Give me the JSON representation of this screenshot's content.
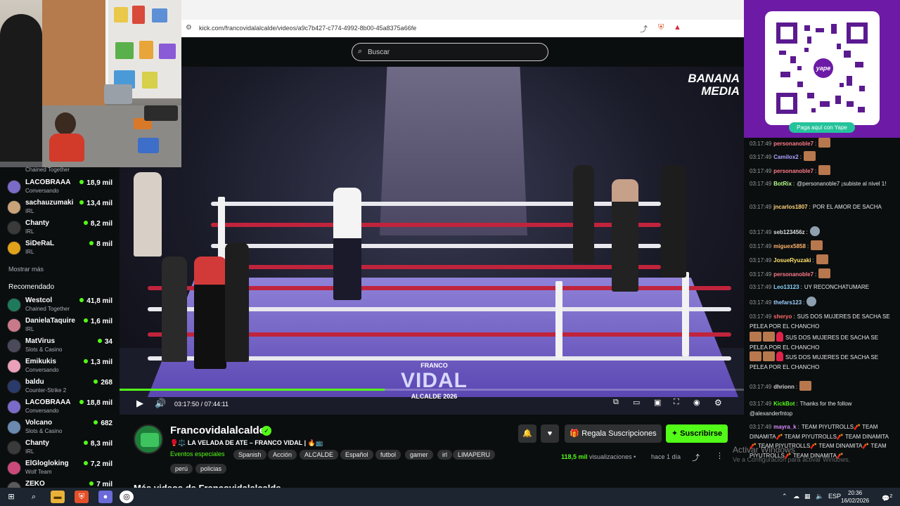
{
  "browser": {
    "url": "kick.com/francovidalalcalde/videos/a9c7b427-c774-4992-8b00-45a8375a66fe"
  },
  "header": {
    "search_placeholder": "Buscar"
  },
  "sidebar": {
    "top_partial_category": "Chained Together",
    "following": [
      {
        "name": "LACOBRAAA",
        "category": "Conversando",
        "viewers": "18,9 mil"
      },
      {
        "name": "sachauzumaki",
        "category": "IRL",
        "viewers": "13,4 mil"
      },
      {
        "name": "Chanty",
        "category": "IRL",
        "viewers": "8,2 mil"
      },
      {
        "name": "SiDeRaL",
        "category": "IRL",
        "viewers": "8 mil"
      }
    ],
    "show_more": "Mostrar más",
    "recommended_label": "Recomendado",
    "recommended": [
      {
        "name": "Westcol",
        "category": "Chained Together",
        "viewers": "41,8 mil"
      },
      {
        "name": "DanielaTaquire",
        "category": "IRL",
        "viewers": "1,6 mil"
      },
      {
        "name": "MatVirus",
        "category": "Slots & Casino",
        "viewers": "34"
      },
      {
        "name": "Emikukis",
        "category": "Conversando",
        "viewers": "1,3 mil"
      },
      {
        "name": "baldu",
        "category": "Counter-Strike 2",
        "viewers": "268"
      },
      {
        "name": "LACOBRAAA",
        "category": "Conversando",
        "viewers": "18,8 mil"
      },
      {
        "name": "Volcano",
        "category": "Slots & Casino",
        "viewers": "682"
      },
      {
        "name": "Chanty",
        "category": "IRL",
        "viewers": "8,3 mil"
      },
      {
        "name": "ElGlogloking",
        "category": "Wolf Team",
        "viewers": "7,2 mil"
      },
      {
        "name": "ZEKO",
        "category": "",
        "viewers": "7 mil"
      }
    ]
  },
  "video": {
    "watermark_line1": "BANANA",
    "watermark_line2": "MEDIA",
    "banner_small": "FRANCO",
    "banner_big": "VIDAL",
    "banner_sub": "ALCALDE 2026",
    "current_time": "03:17:50",
    "separator": "/",
    "duration": "07:44:11",
    "progress_fraction": 0.425
  },
  "channel": {
    "name": "Francovidalalcalde",
    "title": "🥊⚖️  LA VELADA DE ATE – FRANCO VIDAL | 🔥📺",
    "category": "Eventos especiales",
    "tags": [
      "Spanish",
      "Acción",
      "ALCALDE",
      "Español",
      "futbol",
      "gamer",
      "irl",
      "LIMAPERU",
      "perú",
      "policias"
    ],
    "gift_label": "Regala Suscripciones",
    "subscribe_label": "Suscribirse",
    "views_count": "118,5 mil",
    "views_word": "visualizaciones",
    "dot": "•",
    "ago": "hace 1 día",
    "more_videos": "Más videos de Francovidalalcalde"
  },
  "qr": {
    "brand": "yape",
    "caption": "Paga aquí con Yape"
  },
  "chat": [
    {
      "time": "03:17:49",
      "user": "personanoble7",
      "color": "#ff7a8a",
      "text": "",
      "emotes": 1
    },
    {
      "time": "03:17:49",
      "user": "Camilox2",
      "color": "#a9a3ff",
      "text": "",
      "emotes": 1
    },
    {
      "time": "03:17:49",
      "user": "personanoble7",
      "color": "#ff7a8a",
      "text": "",
      "emotes": 1
    },
    {
      "time": "03:17:49",
      "user": "BotRix",
      "color": "#b6ff8a",
      "text": "@personanoble7 ¡subiste al nivel 1!",
      "emotes": 0
    },
    {
      "time": "03:17:49",
      "user": "jncarlos1807",
      "color": "#ffd37a",
      "text": "POR EL AMOR DE SACHA",
      "emotes": 0
    },
    {
      "time": "03:17:49",
      "user": "seb123456z",
      "color": "#dddddd",
      "text": "",
      "emotes": 1
    },
    {
      "time": "03:17:49",
      "user": "miguex5858",
      "color": "#ffb36b",
      "text": "",
      "emotes": 1
    },
    {
      "time": "03:17:49",
      "user": "JosueRyuzaki",
      "color": "#ffe36b",
      "text": "",
      "emotes": 1
    },
    {
      "time": "03:17:49",
      "user": "personanoble7",
      "color": "#ff7a8a",
      "text": "",
      "emotes": 1
    },
    {
      "time": "03:17:49",
      "user": "Leo13123",
      "color": "#8ad2ff",
      "text": "UY RECONCHATUMARE",
      "emotes": 0
    },
    {
      "time": "03:17:49",
      "user": "thefars123",
      "color": "#9ad0ff",
      "text": "",
      "emotes": 1
    },
    {
      "time": "03:17:49",
      "user": "sheryo",
      "color": "#ff6b6b",
      "text": "SUS DOS MUJERES DE SACHA SE PELEA POR EL CHANCHO",
      "emotes": 0
    },
    {
      "time": "",
      "user": "",
      "color": "#ffffff",
      "text": "SUS DOS MUJERES DE SACHA SE PELEA POR EL CHANCHO",
      "emotes": 0
    },
    {
      "time": "",
      "user": "",
      "color": "#ffffff",
      "text": "SUS DOS MUJERES DE SACHA SE PELEA POR EL CHANCHO",
      "emotes": 0
    },
    {
      "time": "03:17:49",
      "user": "dhrionn",
      "color": "#cfcfcf",
      "text": "",
      "emotes": 1
    },
    {
      "time": "03:17:49",
      "user": "KickBot",
      "color": "#53fc18",
      "text": "Thanks for the follow @alexanderfntop",
      "emotes": 0
    },
    {
      "time": "03:17:49",
      "user": "mayra_k",
      "color": "#d98cff",
      "text": "TEAM PIYUTROLLS🧨 TEAM DINAMITA🧨 TEAM PIYUTROLLS🧨 TEAM DINAMITA🧨 TEAM PIYUTROLLS🧨 TEAM DINAMITA🧨 TEAM PIYUTROLLS🧨 TEAM DINAMITA🧨",
      "emotes": 0
    }
  ],
  "watermark": {
    "line1": "Activar Windows",
    "line2": "Ve a Configuración para activar Windows."
  },
  "taskbar": {
    "lang": "ESP",
    "time": "20:36",
    "date": "16/02/2026",
    "notif_count": "2"
  }
}
